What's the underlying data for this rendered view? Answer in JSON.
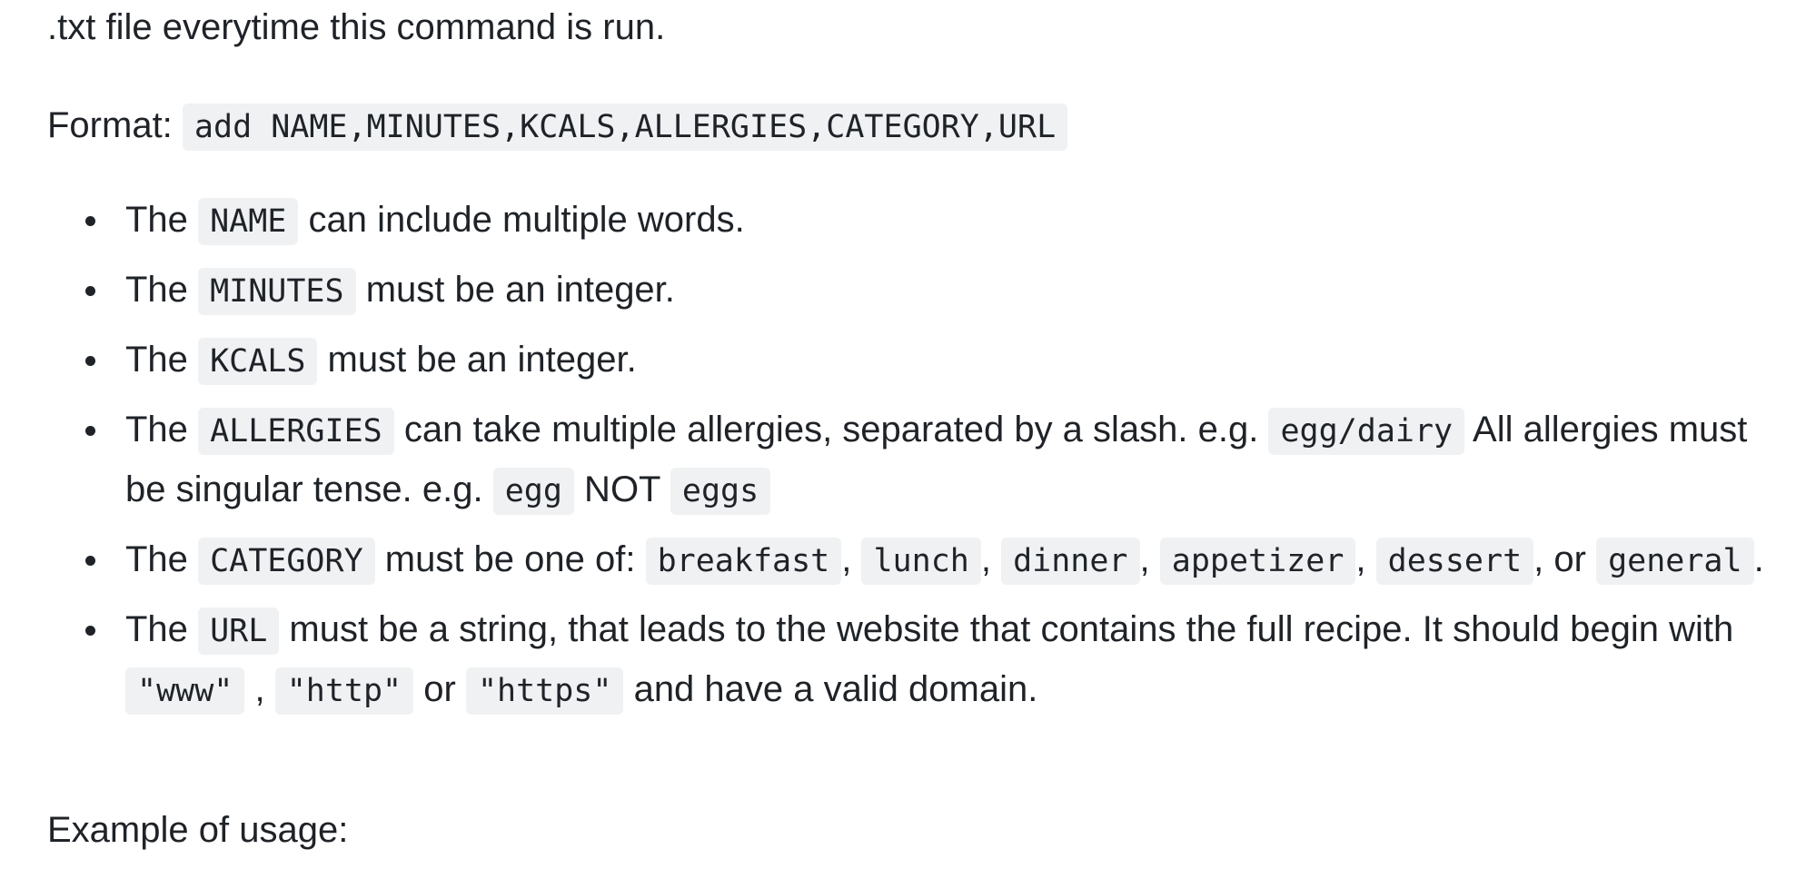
{
  "intro_text": ".txt file everytime this command is run.",
  "format": {
    "label": "Format:",
    "code": "add NAME,MINUTES,KCALS,ALLERGIES,CATEGORY,URL"
  },
  "rules": [
    {
      "the": "The",
      "code": "NAME",
      "text": " can include multiple words."
    },
    {
      "the": "The",
      "code": "MINUTES",
      "text": " must be an integer."
    },
    {
      "the": "The",
      "code": "KCALS",
      "text": " must be an integer."
    },
    {
      "the": "The",
      "code": "ALLERGIES",
      "text1": " can take multiple allergies, separated by a slash. e.g. ",
      "example_code": "egg/dairy",
      "text2": " All allergies must be singular tense. e.g. ",
      "correct_code": "egg",
      "not_text": " NOT ",
      "wrong_code": "eggs"
    },
    {
      "the": "The",
      "code": "CATEGORY",
      "text1": " must be one of: ",
      "options": [
        "breakfast",
        "lunch",
        "dinner",
        "appetizer",
        "dessert",
        "general"
      ],
      "comma": ", ",
      "or_text": ", or ",
      "end": "."
    },
    {
      "the": "The",
      "code": "URL",
      "text1": " must be a string, that leads to the website that contains the full recipe. It should begin with ",
      "prefix1": "\"www\"",
      "comma": " , ",
      "prefix2": "\"http\"",
      "or_text": " or ",
      "prefix3": "\"https\"",
      "text2": " and have a valid domain."
    }
  ],
  "example_label": "Example of usage:"
}
